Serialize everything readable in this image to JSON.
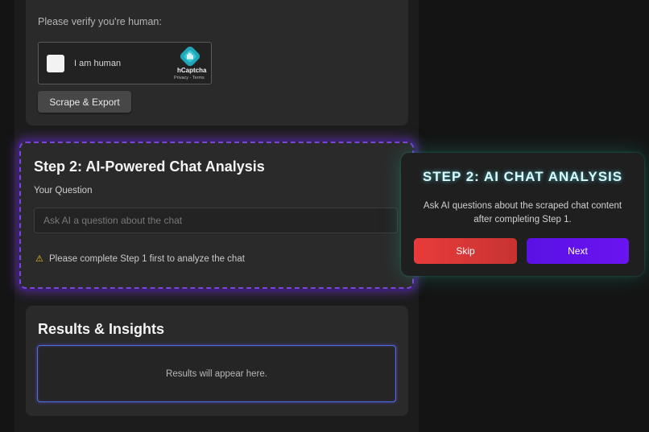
{
  "step1": {
    "verify_label": "Please verify you're human:",
    "captcha": {
      "label": "I am human",
      "brand": "hCaptcha",
      "links": "Privacy - Terms"
    },
    "scrape_button": "Scrape & Export"
  },
  "step2": {
    "title": "Step 2: AI-Powered Chat Analysis",
    "question_label": "Your Question",
    "question_placeholder": "Ask AI a question about the chat",
    "warning": "Please complete Step 1 first to analyze the chat",
    "warning_icon": "warning-icon"
  },
  "results": {
    "title": "Results & Insights",
    "placeholder_text": "Results will appear here."
  },
  "tour": {
    "title": "STEP 2: AI CHAT ANALYSIS",
    "description": "Ask AI questions about the scraped chat content after completing Step 1.",
    "skip_label": "Skip",
    "next_label": "Next"
  },
  "colors": {
    "background": "#141414",
    "card": "#2a2a2a",
    "highlight": "#7b45d6",
    "skip": "#e83b3b",
    "next": "#6a14f0",
    "tour_glow": "#5af0ff"
  }
}
